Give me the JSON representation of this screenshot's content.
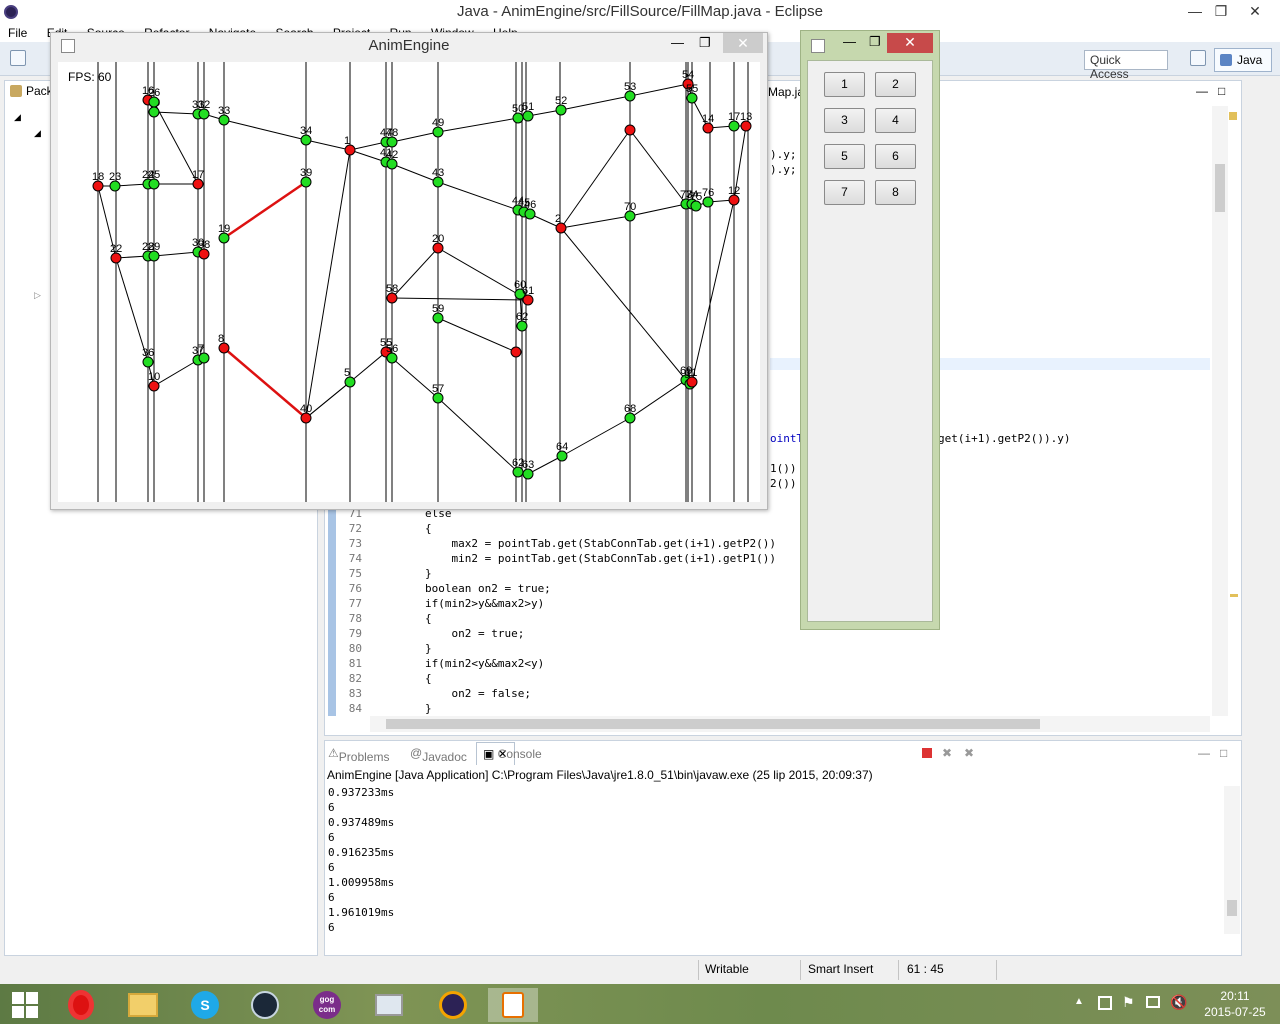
{
  "eclipse": {
    "title": "Java - AnimEngine/src/FillSource/FillMap.java - Eclipse",
    "menu": [
      "File",
      "Edit",
      "Source",
      "Refactor",
      "Navigate",
      "Search",
      "Project",
      "Run",
      "Window",
      "Help"
    ],
    "quick_access": "Quick Access",
    "perspective": "Java",
    "package_explorer_tab": "Pack",
    "editor_tab": "Map.ja",
    "code_right_fragments": [
      ").y;",
      ").y;",
      "ointT",
      "get(i+1).getP2()).y)",
      "1())",
      "2())"
    ],
    "line_numbers": [
      "71",
      "72",
      "73",
      "74",
      "75",
      "76",
      "77",
      "78",
      "79",
      "80",
      "81",
      "82",
      "83",
      "84"
    ],
    "code_lines": [
      "        else",
      "        {",
      "            max2 = pointTab.get(StabConnTab.get(i+1).getP2())",
      "            min2 = pointTab.get(StabConnTab.get(i+1).getP1())",
      "        }",
      "        boolean on2 = true;",
      "        if(min2>y&&max2>y)",
      "        {",
      "            on2 = true;",
      "        }",
      "        if(min2<y&&max2<y)",
      "        {",
      "            on2 = false;",
      "        }"
    ],
    "console": {
      "tabs": [
        "Problems",
        "Javadoc",
        "Console"
      ],
      "launch": "AnimEngine [Java Application] C:\\Program Files\\Java\\jre1.8.0_51\\bin\\javaw.exe (25 lip 2015, 20:09:37)",
      "lines": [
        "0.937233ms",
        "6",
        "0.937489ms",
        "6",
        "0.916235ms",
        "6",
        "1.009958ms",
        "6",
        "1.961019ms",
        "6"
      ]
    },
    "status": {
      "writable": "Writable",
      "insert_mode": "Smart Insert",
      "position": "61 : 45"
    }
  },
  "anim": {
    "title": "AnimEngine",
    "fps": "FPS: 60"
  },
  "graph": {
    "node_labels": [
      "18",
      "23",
      "16",
      "60",
      "26",
      "31",
      "32",
      "33",
      "34",
      "1",
      "47",
      "48",
      "49",
      "50",
      "51",
      "52",
      "53",
      "54",
      "55",
      "14",
      "17",
      "13",
      "24",
      "25",
      "17",
      "39",
      "43",
      "41",
      "42",
      "44",
      "45",
      "46",
      "2",
      "70",
      "73",
      "74",
      "75",
      "76",
      "12",
      "22",
      "28",
      "29",
      "30",
      "38",
      "19",
      "20",
      "58",
      "59",
      "60",
      "61",
      "62",
      "36",
      "37",
      "7",
      "8",
      "40",
      "5",
      "55",
      "56",
      "57",
      "62",
      "63",
      "64",
      "68",
      "69",
      "9",
      "11",
      "10"
    ],
    "colors": {
      "green": "#22dd22",
      "red": "#ee1111",
      "red_edge": "#dd1111",
      "edge": "#000000"
    }
  },
  "buttons_window": {
    "buttons": [
      "1",
      "2",
      "3",
      "4",
      "5",
      "6",
      "7",
      "8"
    ]
  },
  "taskbar": {
    "apps": [
      "start-icon",
      "opera-icon",
      "explorer-icon",
      "skype-icon",
      "steam-icon",
      "gog-icon",
      "monitor-icon",
      "eclipse-icon",
      "java-icon"
    ],
    "gog_label": "gog com",
    "time": "20:11",
    "date": "2015-07-25"
  }
}
